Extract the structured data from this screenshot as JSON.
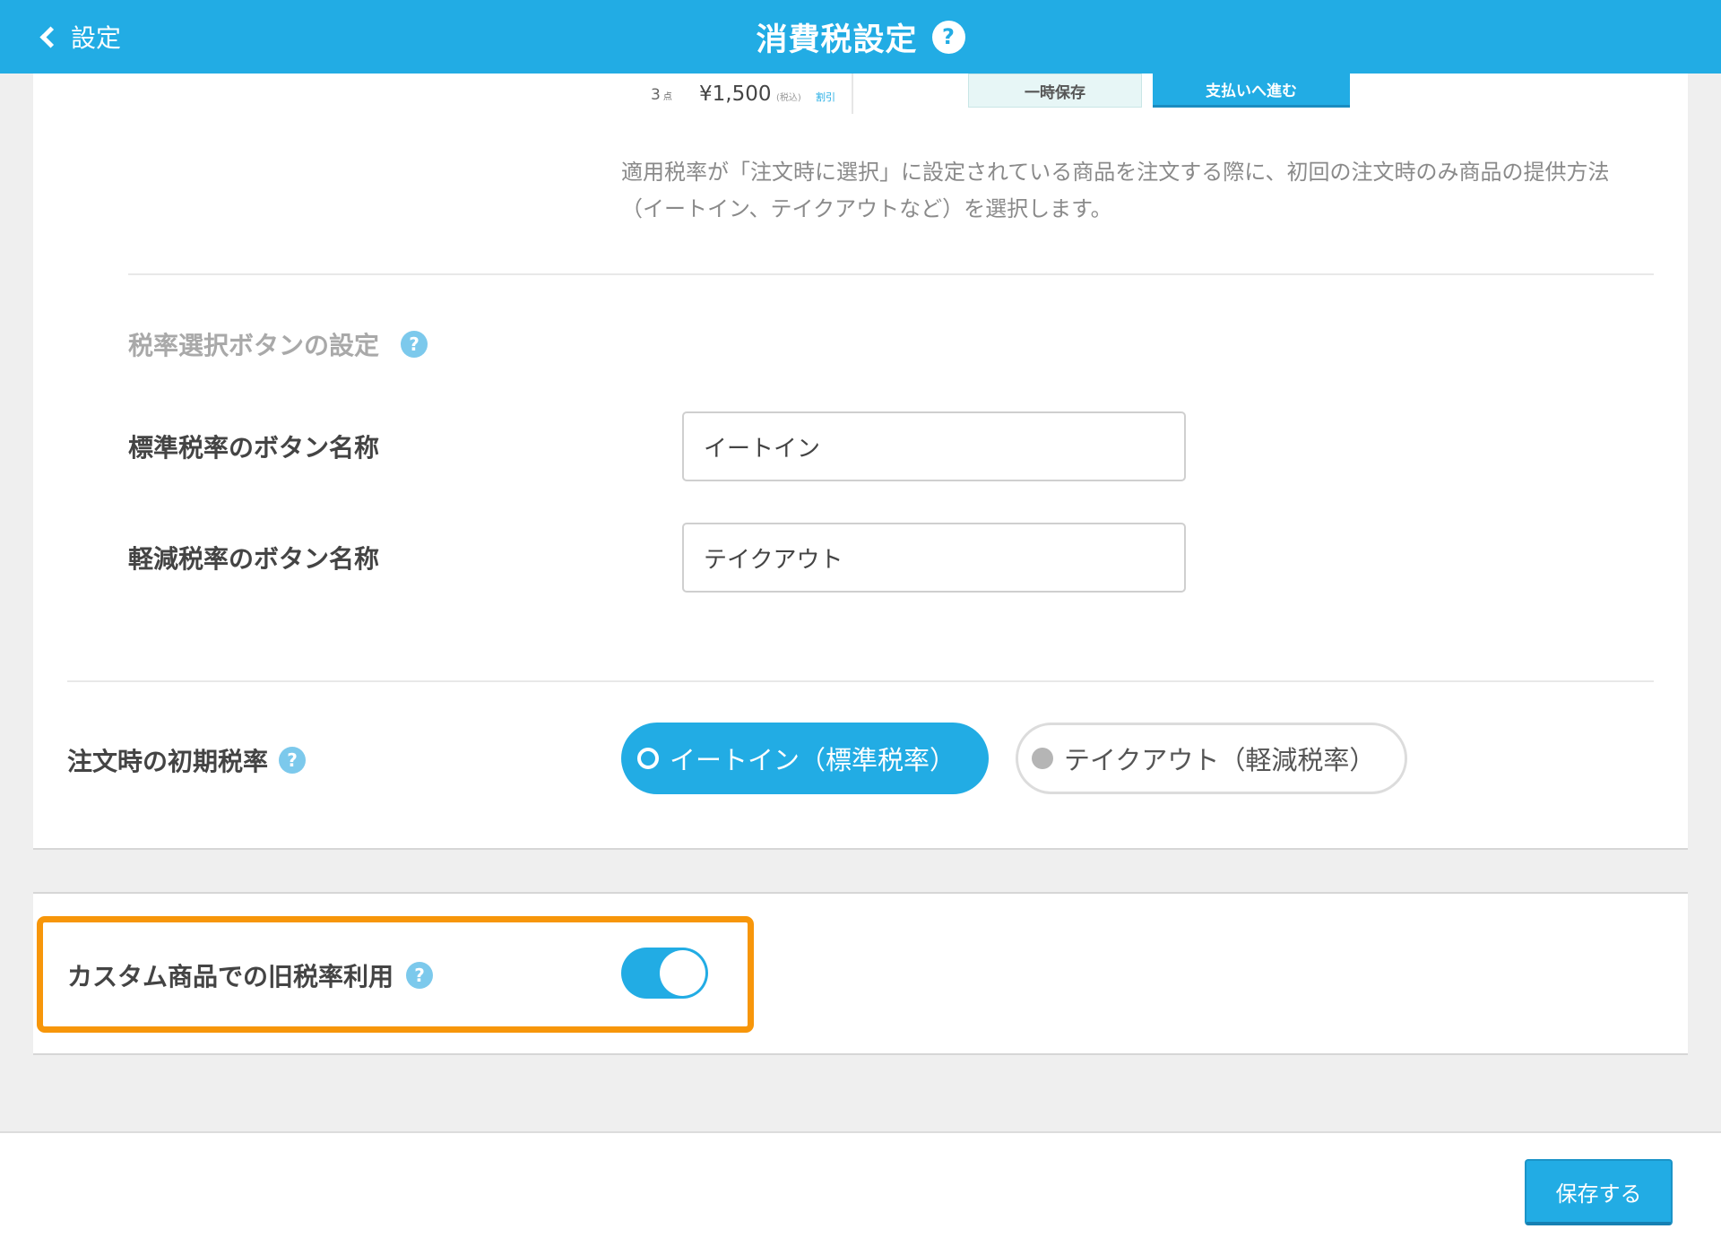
{
  "header": {
    "back_label": "設定",
    "title": "消費税設定",
    "help_glyph": "?"
  },
  "preview": {
    "count": "3",
    "count_unit": "点",
    "price": "¥1,500",
    "tax_note": "(税込)",
    "discount": "割引",
    "save_temp_label": "一時保存",
    "proceed_label": "支払いへ進む"
  },
  "description": "適用税率が「注文時に選択」に設定されている商品を注文する際に、初回の注文時のみ商品の提供方法（イートイン、テイクアウトなど）を選択します。",
  "tax_button_settings": {
    "heading": "税率選択ボタンの設定",
    "standard_label": "標準税率のボタン名称",
    "standard_value": "イートイン",
    "reduced_label": "軽減税率のボタン名称",
    "reduced_value": "テイクアウト"
  },
  "initial_rate": {
    "label": "注文時の初期税率",
    "options": [
      {
        "label": "イートイン（標準税率）",
        "selected": true
      },
      {
        "label": "テイクアウト（軽減税率）",
        "selected": false
      }
    ]
  },
  "custom_product": {
    "label": "カスタム商品での旧税率利用",
    "enabled": true
  },
  "footer": {
    "save_label": "保存する"
  },
  "colors": {
    "accent": "#22ace4",
    "highlight": "#f7960a",
    "help_icon": "#7cc9ec"
  }
}
